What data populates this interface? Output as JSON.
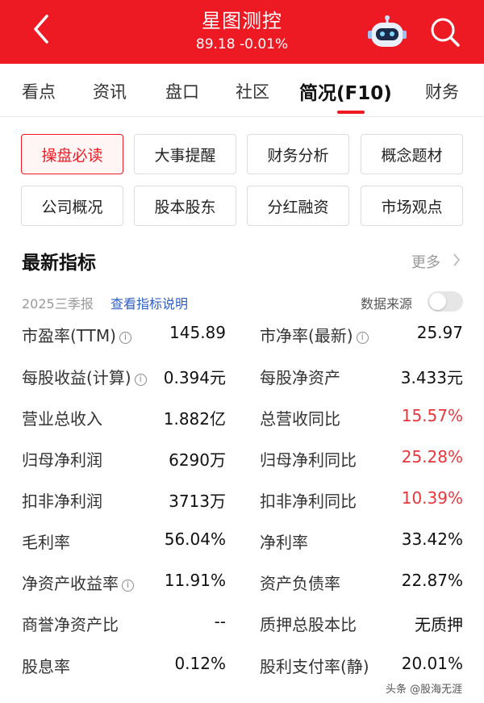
{
  "header": {
    "title": "星图测控",
    "price_change": "89.18 -0.01%"
  },
  "tabs": [
    {
      "label": "看点"
    },
    {
      "label": "资讯"
    },
    {
      "label": "盘口"
    },
    {
      "label": "社区"
    },
    {
      "label": "简况(F10)"
    },
    {
      "label": "财务"
    }
  ],
  "buttons": [
    {
      "label": "操盘必读"
    },
    {
      "label": "大事提醒"
    },
    {
      "label": "财务分析"
    },
    {
      "label": "概念题材"
    },
    {
      "label": "公司概况"
    },
    {
      "label": "股本股东"
    },
    {
      "label": "分红融资"
    },
    {
      "label": "市场观点"
    }
  ],
  "section": {
    "title": "最新指标",
    "more": "更多",
    "report_period": "2025三季报",
    "report_link": "查看指标说明",
    "source_label": "数据来源"
  },
  "metrics": [
    {
      "left_label": "市盈率(TTM)",
      "left_value": "145.89",
      "right_label": "市净率(最新)",
      "right_value": "25.97"
    },
    {
      "left_label": "每股收益(计算)",
      "left_value": "0.394元",
      "right_label": "每股净资产",
      "right_value": "3.433元"
    },
    {
      "left_label": "营业总收入",
      "left_value": "1.882亿",
      "right_label": "总营收同比",
      "right_value": "15.57%"
    },
    {
      "left_label": "归母净利润",
      "left_value": "6290万",
      "right_label": "归母净利同比",
      "right_value": "25.28%"
    },
    {
      "left_label": "扣非净利润",
      "left_value": "3713万",
      "right_label": "扣非净利同比",
      "right_value": "10.39%"
    },
    {
      "left_label": "毛利率",
      "left_value": "56.04%",
      "right_label": "净利率",
      "right_value": "33.42%"
    },
    {
      "left_label": "净资产收益率",
      "left_value": "11.91%",
      "right_label": "资产负债率",
      "right_value": "22.87%"
    },
    {
      "left_label": "商誉净资产比",
      "left_value": "--",
      "right_label": "质押总股本比",
      "right_value": "无质押"
    },
    {
      "left_label": "股息率",
      "left_value": "0.12%",
      "right_label": "股利支付率(静)",
      "right_value": "20.01%"
    }
  ],
  "watermark": {
    "text": "头条 @股海无涯"
  },
  "colors": {
    "brand_red": "#ed1a24",
    "value_red": "#e8363d",
    "link_blue": "#2f5fc4"
  }
}
